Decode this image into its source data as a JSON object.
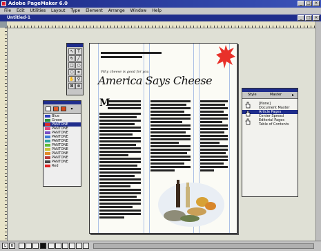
{
  "app": {
    "title": "Adobe PageMaker 6.0",
    "menus": [
      "File",
      "Edit",
      "Utilities",
      "Layout",
      "Type",
      "Element",
      "Arrange",
      "Window",
      "Help"
    ],
    "document_title": "Untitled-1"
  },
  "page": {
    "tagline": "Why cheese is good for you",
    "headline": "America Says Cheese",
    "drop_cap": "M"
  },
  "toolbox": {
    "tools": [
      "pointer-icon",
      "text-icon",
      "rotate-icon",
      "line-icon",
      "rectangle-icon",
      "ellipse-icon",
      "polygon-icon",
      "crop-icon",
      "hand-icon",
      "zoom-icon"
    ]
  },
  "colors_palette": {
    "selected": "PANTONE",
    "items": [
      {
        "name": "Blue",
        "color": "#2a3fbf"
      },
      {
        "name": "Green",
        "color": "#2f8f3a"
      },
      {
        "name": "PANTONE",
        "color": "#d62a2a"
      },
      {
        "name": "PANTONE",
        "color": "#e0457b"
      },
      {
        "name": "PANTONE",
        "color": "#7a4fc4"
      },
      {
        "name": "PANTONE",
        "color": "#3a7bd5"
      },
      {
        "name": "PANTONE",
        "color": "#2aa3a0"
      },
      {
        "name": "PANTONE",
        "color": "#5dbb3a"
      },
      {
        "name": "PANTONE",
        "color": "#c9c23a"
      },
      {
        "name": "PANTONE",
        "color": "#e08a2a"
      },
      {
        "name": "PANTONE",
        "color": "#b93a3a"
      },
      {
        "name": "PANTONE",
        "color": "#444444"
      },
      {
        "name": "Red",
        "color": "#e02020"
      }
    ]
  },
  "styles_palette": {
    "tabs": [
      "Style",
      "Master"
    ],
    "selected": "Article Pages",
    "items": [
      "[None]",
      "Document Master",
      "Article Pages",
      "Center Spread",
      "Editorial Pages",
      "Table of Contents"
    ]
  },
  "accent": {
    "starburst": "#e8312a",
    "titlebar": "#1f2d8c"
  }
}
